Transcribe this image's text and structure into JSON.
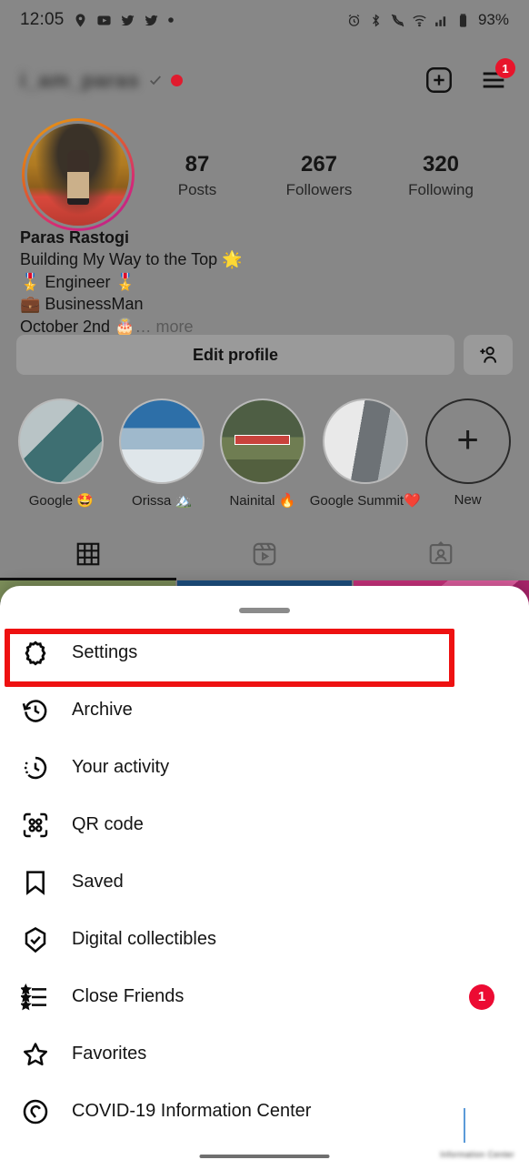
{
  "status_bar": {
    "time": "12:05",
    "battery": "93%",
    "left_icons": [
      "location-pin-icon",
      "youtube-icon",
      "twitter-icon",
      "twitter-icon",
      "dot-icon"
    ],
    "right_icons": [
      "alarm-icon",
      "bluetooth-icon",
      "call-mute-icon",
      "wifi-icon",
      "cellular-signal-icon",
      "battery-icon"
    ]
  },
  "top_nav": {
    "username": "i_am_paras",
    "verified_tick_icon": "check-icon",
    "live_dot_icon": "red-dot-icon",
    "add_post_icon": "plus-square-icon",
    "menu_icon": "hamburger-menu-icon",
    "menu_badge": "1"
  },
  "profile": {
    "avatar_label": "profile-picture",
    "stats": [
      {
        "value": "87",
        "label": "Posts"
      },
      {
        "value": "267",
        "label": "Followers"
      },
      {
        "value": "320",
        "label": "Following"
      }
    ],
    "bio": {
      "name": "Paras Rastogi",
      "lines": [
        "Building My Way to the Top 🌟",
        "🎖️ Engineer 🎖️",
        "💼 BusinessMan"
      ],
      "last_line": "October 2nd 🎂",
      "more_label": "… more"
    }
  },
  "actions": {
    "edit_profile_label": "Edit profile",
    "add_people_icon": "add-person-icon"
  },
  "highlights": [
    {
      "label": "Google 🤩",
      "img": "hl-img-0"
    },
    {
      "label": "Orissa 🏔️",
      "img": "hl-img-1"
    },
    {
      "label": "Nainital 🔥",
      "img": "hl-img-2"
    },
    {
      "label": "Google Summit❤️",
      "img": "hl-img-3"
    },
    {
      "label": "New",
      "img": "new"
    }
  ],
  "tabs": [
    {
      "name": "grid",
      "icon": "grid-icon",
      "active": true
    },
    {
      "name": "reels",
      "icon": "reels-icon",
      "active": false
    },
    {
      "name": "tagged",
      "icon": "tagged-person-icon",
      "active": false
    }
  ],
  "sheet": {
    "drag_handle": "drag-handle",
    "items": [
      {
        "label": "Settings",
        "icon": "settings-gear-icon",
        "badge": null,
        "highlighted": true
      },
      {
        "label": "Archive",
        "icon": "archive-clock-icon",
        "badge": null,
        "highlighted": false
      },
      {
        "label": "Your activity",
        "icon": "activity-clock-icon",
        "badge": null,
        "highlighted": false
      },
      {
        "label": "QR code",
        "icon": "qr-code-icon",
        "badge": null,
        "highlighted": false
      },
      {
        "label": "Saved",
        "icon": "bookmark-icon",
        "badge": null,
        "highlighted": false
      },
      {
        "label": "Digital collectibles",
        "icon": "shield-check-icon",
        "badge": null,
        "highlighted": false
      },
      {
        "label": "Close Friends",
        "icon": "close-friends-list-icon",
        "badge": "1",
        "highlighted": false
      },
      {
        "label": "Favorites",
        "icon": "star-icon",
        "badge": null,
        "highlighted": false
      },
      {
        "label": "COVID-19 Information Center",
        "icon": "covid-info-icon",
        "badge": null,
        "highlighted": false
      }
    ]
  },
  "colors": {
    "accent_red": "#ee1111",
    "badge_red": "#ec0b33",
    "dim_overlay": "#878787",
    "sheet_bg": "#ffffff"
  }
}
